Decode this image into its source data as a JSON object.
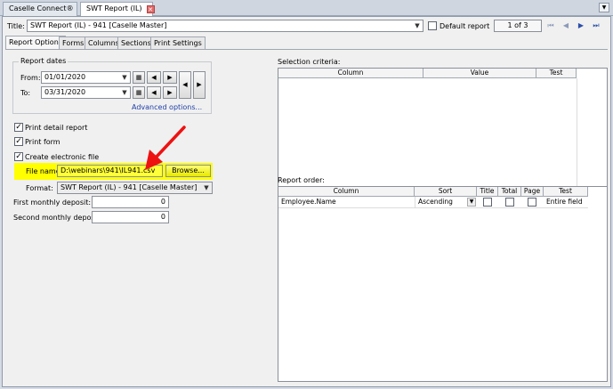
{
  "top_tabs": [
    {
      "label": "Caselle Connect®",
      "active": false
    },
    {
      "label": "SWT Report (IL)",
      "active": true
    }
  ],
  "header": {
    "title_label": "Title:",
    "title_value": "SWT Report (IL) - 941 [Caselle Master]",
    "default_report_label": "Default report",
    "default_report_checked": false,
    "pager": "1 of 3"
  },
  "sub_tabs": [
    "Report Options",
    "Forms",
    "Columns",
    "Sections",
    "Print Settings"
  ],
  "report_dates": {
    "group_label": "Report dates",
    "from_label": "From:",
    "from_value": "01/01/2020",
    "to_label": "To:",
    "to_value": "03/31/2020",
    "advanced_link": "Advanced options..."
  },
  "options": {
    "print_detail": {
      "label": "Print detail report",
      "checked": true
    },
    "print_form": {
      "label": "Print form",
      "checked": true
    },
    "create_file": {
      "label": "Create electronic file",
      "checked": true
    }
  },
  "file": {
    "file_name_label": "File name:",
    "file_name_value": "D:\\webinars\\941\\IL941.csv",
    "browse_label": "Browse...",
    "format_label": "Format:",
    "format_value": "SWT Report (IL) - 941 [Caselle Master]"
  },
  "deposits": {
    "first_label": "First monthly deposit:",
    "first_value": "0",
    "second_label": "Second monthly deposit:",
    "second_value": "0"
  },
  "selection_criteria": {
    "label": "Selection criteria:",
    "columns": [
      "Column",
      "Value",
      "Test"
    ]
  },
  "report_order": {
    "label": "Report order:",
    "columns": [
      "Column",
      "Sort",
      "Title",
      "Total",
      "Page",
      "Test"
    ],
    "rows": [
      {
        "column": "Employee.Name",
        "sort": "Ascending",
        "title": false,
        "total": false,
        "page": false,
        "test": "Entire field"
      }
    ]
  },
  "colors": {
    "highlight": "#ffff00",
    "annotation_arrow": "#ee1111"
  }
}
